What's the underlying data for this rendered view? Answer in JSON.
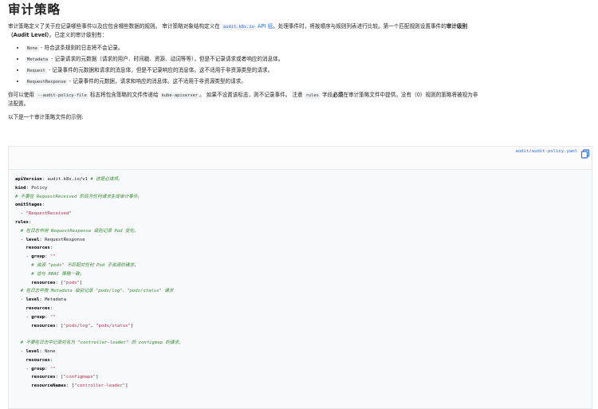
{
  "page": {
    "title": "审计策略",
    "intro": {
      "text1": "审计策略定义了关于应记录哪些事件以及应包含哪些数据的规则。 审计策略对象结构定义在",
      "code_link": "audit.k8s.io",
      "link_text": "API 组",
      "text2": "。处理事件时，将按顺序与规则列表进行比较。第一个匹配规则设置事件的",
      "bold": "审计级别（Audit Level）",
      "text3": "。已定义的审计级别有："
    },
    "levels": [
      {
        "code": "None",
        "desc": " - 符合这条规则的日志将不会记录。"
      },
      {
        "code": "Metadata",
        "desc": " - 记录请求的元数据（请求的用户、时间戳、资源、动词等等），但是不记录请求或者响应的消息体。"
      },
      {
        "code": "Request",
        "desc": " - 记录事件的元数据和请求的消息体，但是不记录响应的消息体。这不适用于非资源类型的请求。"
      },
      {
        "code": "RequestResponse",
        "desc": " - 记录事件的元数据，请求和响应的消息体。这不适用于非资源类型的请求。"
      }
    ],
    "para2": {
      "t1": "你可以使用 ",
      "code1": "--audit-policy-file",
      "t2": " 标志将包含策略的文件传递给 ",
      "code2": "kube-apiserver",
      "t3": "。 如果不设置该标志，则不记录事件。 注意 ",
      "code3": "rules",
      "t4": " 字段",
      "bold": "必须",
      "t5": "在审计策略文件中提供。没有（0）规则的策略将被视为非法配置。"
    },
    "para3": "以下是一个审计策略文件的示例:",
    "code_filename": "audit/audit-policy.yaml",
    "code_lines": [
      [
        {
          "t": "apiVersion",
          "c": "k"
        },
        {
          "t": ": audit.k8s.io/v1 "
        },
        {
          "t": "# 这是必填项。",
          "c": "c"
        }
      ],
      [
        {
          "t": "kind",
          "c": "k"
        },
        {
          "t": ": Policy"
        }
      ],
      [
        {
          "t": "# 不要在 RequestReceived 阶段为任何请求生成审计事件。",
          "c": "c"
        }
      ],
      [
        {
          "t": "omitStages",
          "c": "k"
        },
        {
          "t": ":"
        }
      ],
      [
        {
          "t": "  - "
        },
        {
          "t": "\"RequestReceived\"",
          "c": "s"
        }
      ],
      [
        {
          "t": "rules",
          "c": "k"
        },
        {
          "t": ":"
        }
      ],
      [
        {
          "t": "  "
        },
        {
          "t": "# 在日志中用 RequestResponse 级别记录 Pod 变化。",
          "c": "c"
        }
      ],
      [
        {
          "t": "  - "
        },
        {
          "t": "level",
          "c": "k"
        },
        {
          "t": ": RequestResponse"
        }
      ],
      [
        {
          "t": "    "
        },
        {
          "t": "resources",
          "c": "k"
        },
        {
          "t": ":"
        }
      ],
      [
        {
          "t": "    - "
        },
        {
          "t": "group",
          "c": "k"
        },
        {
          "t": ": "
        },
        {
          "t": "\"\"",
          "c": "s"
        }
      ],
      [
        {
          "t": "      "
        },
        {
          "t": "# 资源 \"pods\" 不匹配对任何 Pod 子资源的请求，",
          "c": "c"
        }
      ],
      [
        {
          "t": "      "
        },
        {
          "t": "# 这与 RBAC 策略一致。",
          "c": "c"
        }
      ],
      [
        {
          "t": "      "
        },
        {
          "t": "resources",
          "c": "k"
        },
        {
          "t": ": ["
        },
        {
          "t": "\"pods\"",
          "c": "s"
        },
        {
          "t": "]"
        }
      ],
      [
        {
          "t": "  "
        },
        {
          "t": "# 在日志中按 Metadata 级别记录 \"pods/log\"、\"pods/status\" 请求",
          "c": "c"
        }
      ],
      [
        {
          "t": "  - "
        },
        {
          "t": "level",
          "c": "k"
        },
        {
          "t": ": Metadata"
        }
      ],
      [
        {
          "t": "    "
        },
        {
          "t": "resources",
          "c": "k"
        },
        {
          "t": ":"
        }
      ],
      [
        {
          "t": "    - "
        },
        {
          "t": "group",
          "c": "k"
        },
        {
          "t": ": "
        },
        {
          "t": "\"\"",
          "c": "s"
        }
      ],
      [
        {
          "t": "      "
        },
        {
          "t": "resources",
          "c": "k"
        },
        {
          "t": ": ["
        },
        {
          "t": "\"pods/log\"",
          "c": "s"
        },
        {
          "t": ", "
        },
        {
          "t": "\"pods/status\"",
          "c": "s"
        },
        {
          "t": "]"
        }
      ],
      [
        {
          "t": ""
        }
      ],
      [
        {
          "t": "  "
        },
        {
          "t": "# 不要在日志中记录对名为 \"controller-leader\" 的 configmap 的请求。",
          "c": "c"
        }
      ],
      [
        {
          "t": "  - "
        },
        {
          "t": "level",
          "c": "k"
        },
        {
          "t": ": None"
        }
      ],
      [
        {
          "t": "    "
        },
        {
          "t": "resources",
          "c": "k"
        },
        {
          "t": ":"
        }
      ],
      [
        {
          "t": "    - "
        },
        {
          "t": "group",
          "c": "k"
        },
        {
          "t": ": "
        },
        {
          "t": "\"\"",
          "c": "s"
        }
      ],
      [
        {
          "t": "      "
        },
        {
          "t": "resources",
          "c": "k"
        },
        {
          "t": ": ["
        },
        {
          "t": "\"configmaps\"",
          "c": "s"
        },
        {
          "t": "]"
        }
      ],
      [
        {
          "t": "      "
        },
        {
          "t": "resourceNames",
          "c": "k"
        },
        {
          "t": ": ["
        },
        {
          "t": "\"controller-leader\"",
          "c": "s"
        },
        {
          "t": "]"
        }
      ]
    ]
  }
}
